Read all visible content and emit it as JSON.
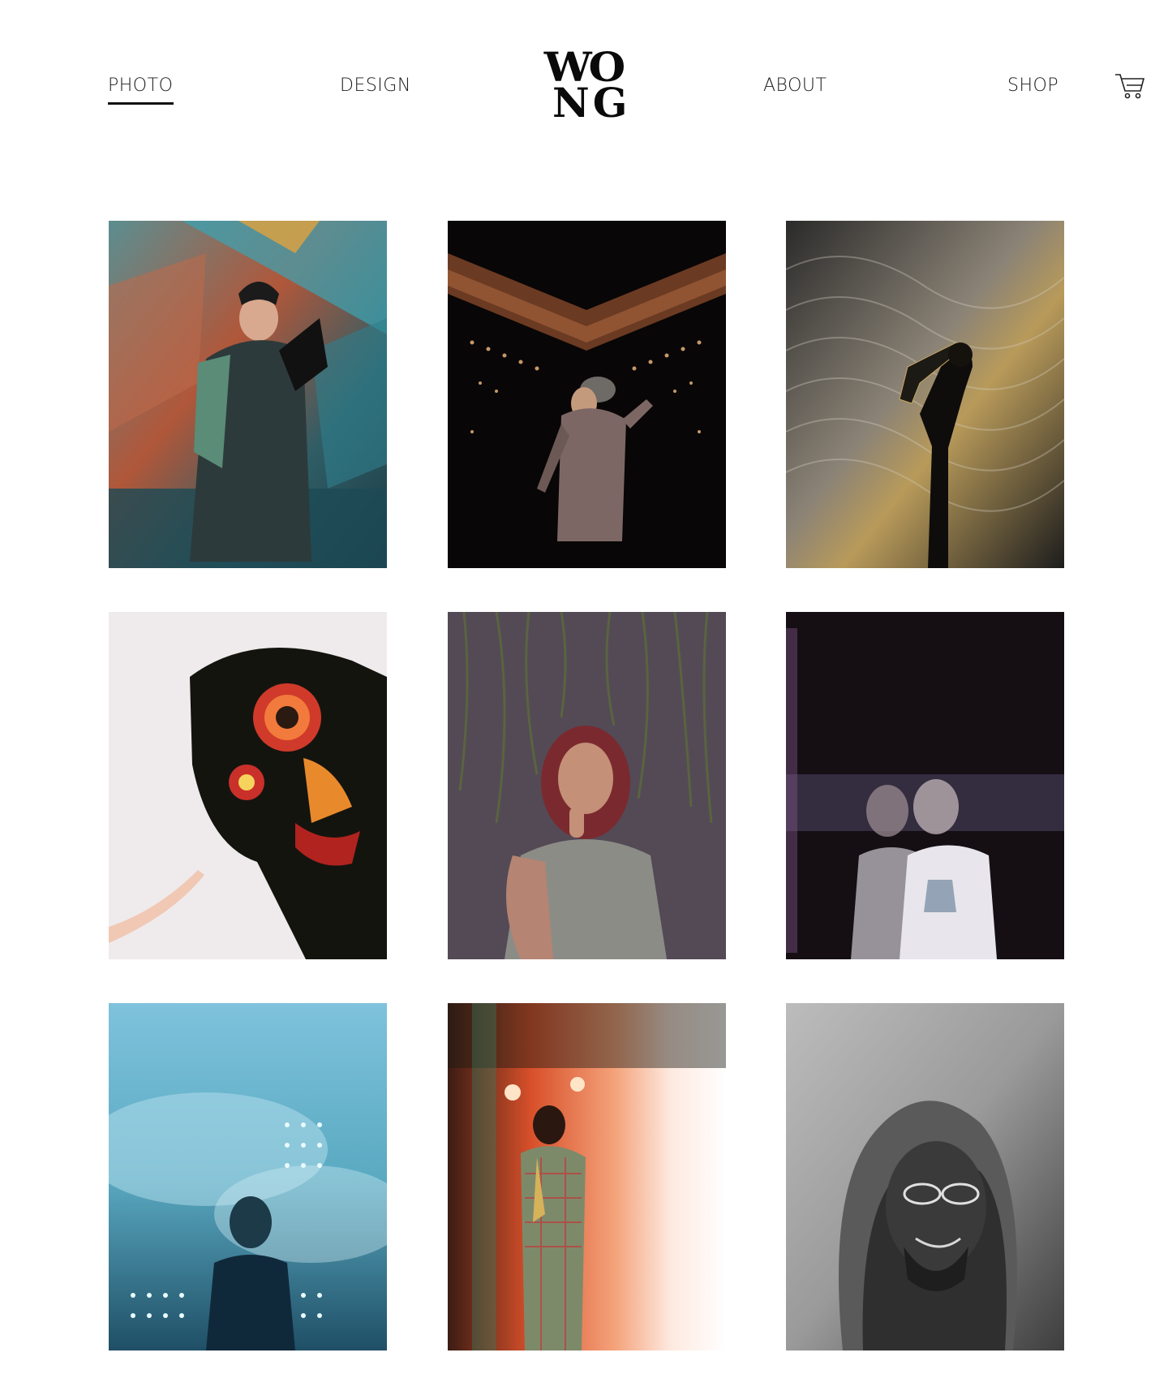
{
  "nav": {
    "photo": "PHOTO",
    "design": "DESIGN",
    "about": "ABOUT",
    "shop": "SHOP",
    "active": "PHOTO"
  },
  "logo": {
    "line1": "WO",
    "line2": "NG"
  },
  "cart": {
    "icon": "cart-icon"
  },
  "gallery": {
    "photos": [
      {
        "subject": "graffiti-tunnel-portrait"
      },
      {
        "subject": "dancer-on-stage"
      },
      {
        "subject": "saxophonist-silhouette"
      },
      {
        "subject": "lion-dance-head"
      },
      {
        "subject": "woman-under-vines"
      },
      {
        "subject": "double-exposure-portrait"
      },
      {
        "subject": "man-blue-smoke-lights"
      },
      {
        "subject": "saxophonist-stage-lights"
      },
      {
        "subject": "man-in-hoodie-bw"
      }
    ]
  },
  "colors": {
    "text": "#1a1a1a",
    "background": "#ffffff",
    "accent": "#111111"
  }
}
